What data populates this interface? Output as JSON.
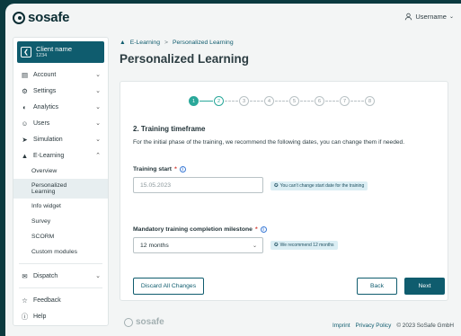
{
  "header": {
    "logo_text": "sosafe",
    "username": "Username"
  },
  "client": {
    "name": "Client name",
    "id": "1234"
  },
  "sidebar": {
    "items": [
      {
        "label": "Account",
        "icon": "document-icon"
      },
      {
        "label": "Settings",
        "icon": "gear-icon"
      },
      {
        "label": "Analytics",
        "icon": "analytics-icon"
      },
      {
        "label": "Users",
        "icon": "users-icon"
      },
      {
        "label": "Simulation",
        "icon": "simulation-icon"
      },
      {
        "label": "E-Learning",
        "icon": "elearning-icon"
      }
    ],
    "elearning_sub": [
      "Overview",
      "Personalized Learning",
      "Info widget",
      "Survey",
      "SCORM",
      "Custom modules"
    ],
    "dispatch": "Dispatch",
    "feedback": "Feedback",
    "help": "Help"
  },
  "breadcrumb": {
    "root": "E-Learning",
    "separator": ">",
    "current": "Personalized Learning"
  },
  "page_title": "Personalized Learning",
  "stepper": {
    "steps": [
      "1",
      "2",
      "3",
      "4",
      "5",
      "6",
      "7",
      "8"
    ],
    "current": 2
  },
  "form": {
    "section_title": "2. Training timeframe",
    "description": "For the initial phase of the training, we recommend the following dates, you can change them if needed.",
    "training_start_label": "Training start",
    "required_mark": "*",
    "training_start_value": "15.05.2023",
    "training_start_hint": "You can't change start date for the training",
    "milestone_label": "Mandatory training completion milestone",
    "milestone_value": "12 months",
    "milestone_hint": "We recommend 12 months"
  },
  "buttons": {
    "discard": "Discard All Changes",
    "back": "Back",
    "next": "Next"
  },
  "footer": {
    "logo_text": "sosafe",
    "imprint": "Imprint",
    "privacy": "Privacy Policy",
    "copyright": "© 2023 SoSafe GmbH"
  },
  "colors": {
    "brand": "#0f5c6e",
    "step_done": "#2aa89a",
    "background": "#0b3a3f"
  }
}
